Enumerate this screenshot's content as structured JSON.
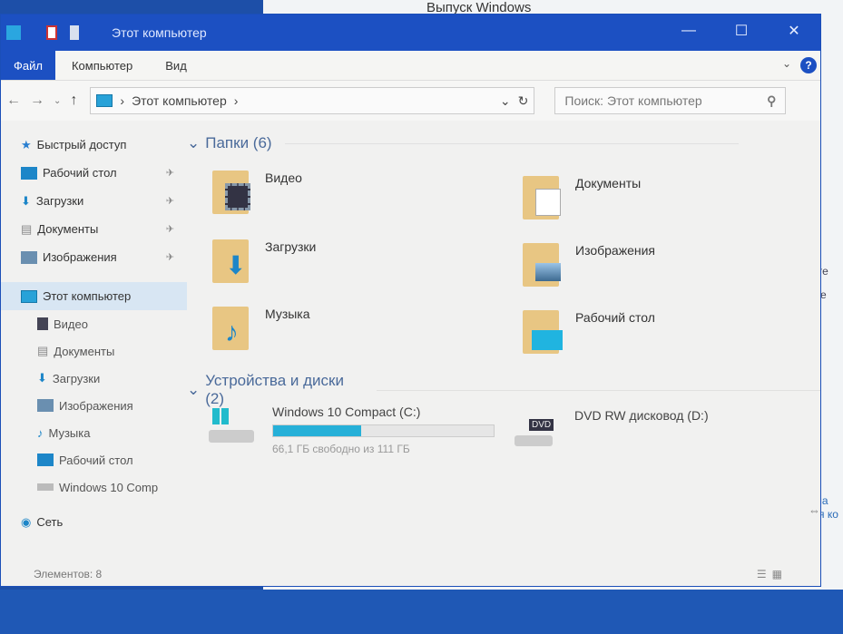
{
  "background": {
    "title": "Выпуск Windows",
    "fragments": [
      "| @",
      "систе",
      "(точе",
      "согла",
      "ения ко"
    ]
  },
  "window": {
    "title": "Этот компьютер",
    "controls": {
      "minimize": "—",
      "maximize": "☐",
      "close": "✕"
    }
  },
  "ribbon": {
    "tabs": [
      "Файл",
      "Компьютер",
      "Вид"
    ],
    "help": "?"
  },
  "address": {
    "path": "Этот компьютер",
    "search_placeholder": "Поиск: Этот компьютер"
  },
  "sidebar": {
    "quick_access": "Быстрый доступ",
    "quick_items": [
      "Рабочий стол",
      "Загрузки",
      "Документы",
      "Изображения"
    ],
    "this_pc": "Этот компьютер",
    "pc_items": [
      "Видео",
      "Документы",
      "Загрузки",
      "Изображения",
      "Музыка",
      "Рабочий стол",
      "Windows 10 Comp"
    ],
    "network": "Сеть"
  },
  "folders": {
    "header": "Папки (6)",
    "items": [
      "Видео",
      "Документы",
      "Загрузки",
      "Изображения",
      "Музыка",
      "Рабочий стол"
    ]
  },
  "devices": {
    "header": "Устройства и диски (2)",
    "drive_c": {
      "name": "Windows 10 Compact  (C:)",
      "free": "66,1 ГБ свободно из 111 ГБ",
      "used_fraction": 0.4
    },
    "dvd": {
      "name": "DVD RW дисковод (D:)",
      "label": "DVD"
    }
  },
  "status": {
    "items": "Элементов: 8"
  }
}
